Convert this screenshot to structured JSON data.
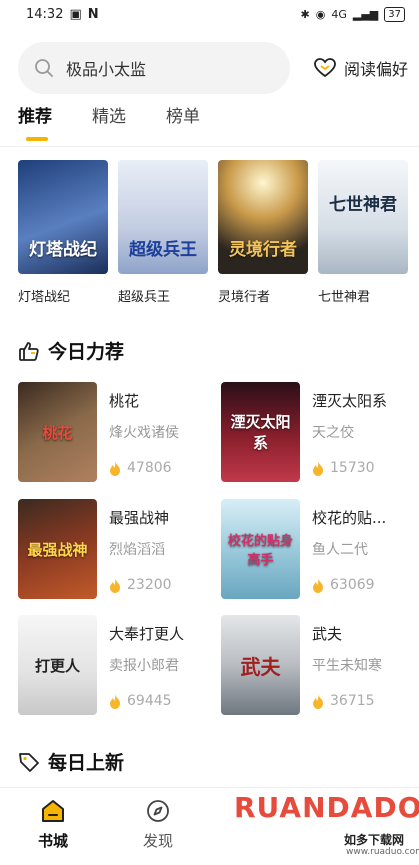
{
  "status_bar": {
    "time": "14:32",
    "network": "4G",
    "battery": "37"
  },
  "search": {
    "placeholder": "极品小太监"
  },
  "header": {
    "preference_label": "阅读偏好"
  },
  "tabs": [
    {
      "label": "推荐",
      "active": true
    },
    {
      "label": "精选",
      "active": false
    },
    {
      "label": "榜单",
      "active": false
    }
  ],
  "top_books": [
    {
      "name": "灯塔战纪",
      "cover_text": "灯塔战纪",
      "color": "#2a4d8f"
    },
    {
      "name": "超级兵王",
      "cover_text": "超级兵王",
      "color": "#c9d3e6"
    },
    {
      "name": "灵境行者",
      "cover_text": "灵境行者",
      "color": "#3a2f2a"
    },
    {
      "name": "七世神君",
      "cover_text": "七世神君",
      "color": "#dfe6ee"
    }
  ],
  "daily_section": {
    "title": "今日力荐"
  },
  "recommendations": [
    {
      "title": "桃花",
      "author": "烽火戏诸侯",
      "heat": "47806",
      "cover_text": "桃花",
      "color": "#6b4b3a"
    },
    {
      "title": "湮灭太阳系",
      "author": "天之佼",
      "heat": "15730",
      "cover_text": "湮灭太阳系",
      "color": "#7a1d2a"
    },
    {
      "title": "最强战神",
      "author": "烈焰滔滔",
      "heat": "23200",
      "cover_text": "最强战神",
      "color": "#7a2f20"
    },
    {
      "title": "校花的贴...",
      "author": "鱼人二代",
      "heat": "63069",
      "cover_text": "校花的贴身高手",
      "color": "#9fc9d8"
    },
    {
      "title": "大奉打更人",
      "author": "卖报小郎君",
      "heat": "69445",
      "cover_text": "打更人",
      "color": "#eeeeee"
    },
    {
      "title": "武夫",
      "author": "平生未知寒",
      "heat": "36715",
      "cover_text": "武夫",
      "color": "#b8bcc0"
    }
  ],
  "new_section": {
    "title": "每日上新"
  },
  "bottom_nav": [
    {
      "label": "书城",
      "active": true
    },
    {
      "label": "发现",
      "active": false
    }
  ],
  "watermark": {
    "logo": "RUANDADO",
    "cn": "如多下载网",
    "url": "www.ruaduo.com"
  },
  "colors": {
    "accent": "#f5b400",
    "flame": "#f7b52c"
  }
}
